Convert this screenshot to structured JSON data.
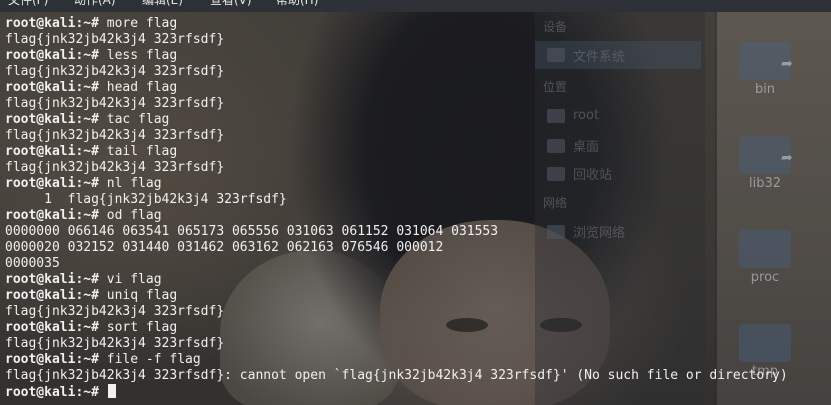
{
  "menubar": {
    "items": [
      "文件(F)",
      "动作(A)",
      "编辑(E)",
      "查看(V)",
      "帮助(H)"
    ]
  },
  "file_manager": {
    "sections": [
      "设备",
      "位置",
      "网络"
    ],
    "sidebar_items": [
      {
        "label": "文件系统",
        "icon": "drive-icon",
        "selected": true
      },
      {
        "label": "root",
        "icon": "home-folder-icon",
        "selected": false
      },
      {
        "label": "桌面",
        "icon": "desktop-icon",
        "selected": false
      },
      {
        "label": "回收站",
        "icon": "trash-icon",
        "selected": false
      },
      {
        "label": "浏览网络",
        "icon": "network-icon",
        "selected": false
      }
    ],
    "folders": [
      "bin",
      "lib32",
      "proc",
      "tmp"
    ]
  },
  "terminal": {
    "prompt": "root@kali:~#",
    "lines": [
      {
        "type": "cmd",
        "text": " more flag"
      },
      {
        "type": "out",
        "text": "flag{jnk32jb42k3j4 323rfsdf}"
      },
      {
        "type": "cmd",
        "text": " less flag"
      },
      {
        "type": "out",
        "text": "flag{jnk32jb42k3j4 323rfsdf}"
      },
      {
        "type": "cmd",
        "text": " head flag"
      },
      {
        "type": "out",
        "text": "flag{jnk32jb42k3j4 323rfsdf}"
      },
      {
        "type": "cmd",
        "text": " tac flag"
      },
      {
        "type": "out",
        "text": "flag{jnk32jb42k3j4 323rfsdf}"
      },
      {
        "type": "cmd",
        "text": " tail flag"
      },
      {
        "type": "out",
        "text": "flag{jnk32jb42k3j4 323rfsdf}"
      },
      {
        "type": "cmd",
        "text": " nl flag"
      },
      {
        "type": "out",
        "text": "     1  flag{jnk32jb42k3j4 323rfsdf}"
      },
      {
        "type": "cmd",
        "text": " od flag"
      },
      {
        "type": "out",
        "text": "0000000 066146 063541 065173 065556 031063 061152 031064 031553"
      },
      {
        "type": "out",
        "text": "0000020 032152 031440 031462 063162 062163 076546 000012"
      },
      {
        "type": "out",
        "text": "0000035"
      },
      {
        "type": "cmd",
        "text": " vi flag"
      },
      {
        "type": "cmd",
        "text": " uniq flag"
      },
      {
        "type": "out",
        "text": "flag{jnk32jb42k3j4 323rfsdf}"
      },
      {
        "type": "cmd",
        "text": " sort flag"
      },
      {
        "type": "out",
        "text": "flag{jnk32jb42k3j4 323rfsdf}"
      },
      {
        "type": "cmd",
        "text": " file -f flag"
      },
      {
        "type": "out",
        "text": "flag{jnk32jb42k3j4 323rfsdf}: cannot open `flag{jnk32jb42k3j4 323rfsdf}' (No such file or directory)"
      },
      {
        "type": "cmd",
        "text": " "
      }
    ]
  }
}
